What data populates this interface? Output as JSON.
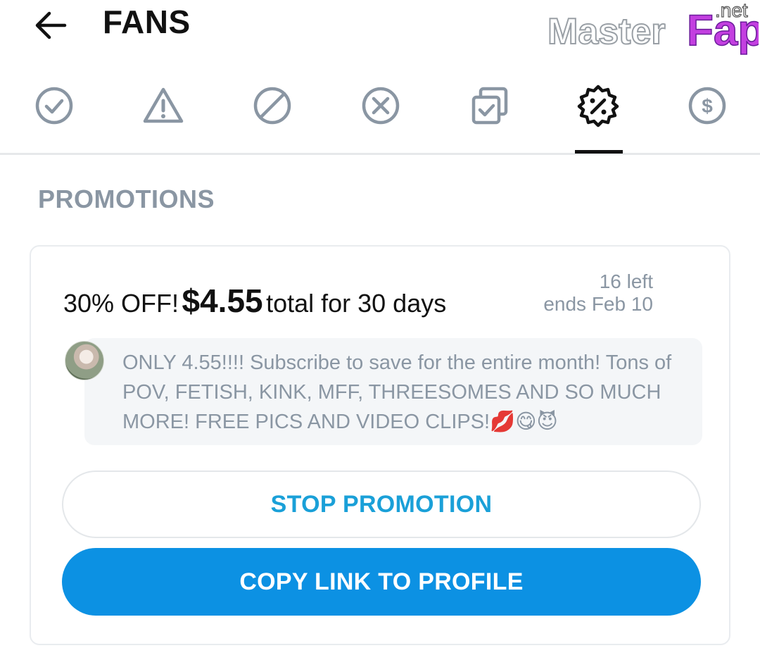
{
  "header": {
    "title": "FANS",
    "back_icon": "arrow-left-icon"
  },
  "watermark": {
    "brand_left": "Master",
    "brand_right": "Fap",
    "suffix": ".net"
  },
  "tabs": [
    {
      "icon": "check-circle-icon",
      "active": false
    },
    {
      "icon": "warning-triangle-icon",
      "active": false
    },
    {
      "icon": "blocked-circle-icon",
      "active": false
    },
    {
      "icon": "x-circle-icon",
      "active": false
    },
    {
      "icon": "stacked-check-icon",
      "active": false
    },
    {
      "icon": "percent-badge-icon",
      "active": true
    },
    {
      "icon": "dollar-circle-icon",
      "active": false
    }
  ],
  "section": {
    "heading": "PROMOTIONS"
  },
  "promotion": {
    "discount": "30% OFF!",
    "price": "$4.55",
    "duration": "total for 30 days",
    "left": "16 left",
    "ends": "ends Feb 10",
    "message": "ONLY 4.55!!!! Subscribe to save for the entire month! Tons of POV, FETISH, KINK, MFF, THREESOMES AND SO MUCH MORE! FREE PICS AND VIDEO CLIPS!",
    "emojis": "💋😋😈"
  },
  "buttons": {
    "stop": "STOP PROMOTION",
    "copy": "COPY LINK TO PROFILE"
  },
  "colors": {
    "accent": "#0c91e3",
    "accent_text": "#1aa0d8",
    "muted": "#8a96a3"
  }
}
